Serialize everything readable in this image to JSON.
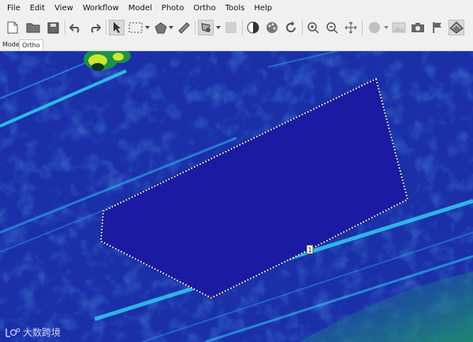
{
  "menu": [
    "File",
    "Edit",
    "View",
    "Workflow",
    "Model",
    "Photo",
    "Ortho",
    "Tools",
    "Help"
  ],
  "toolbar": {
    "icons": [
      "new-document-icon",
      "open-folder-icon",
      "save-icon",
      "undo-icon",
      "redo-icon",
      "pointer-icon",
      "rectangle-selection-icon",
      "polygon-selection-icon",
      "ruler-icon",
      "shape-draw-icon",
      "dense-cloud-icon",
      "contrast-icon",
      "palette-icon",
      "refresh-icon",
      "zoom-in-icon",
      "zoom-out-icon",
      "move-icon",
      "terrain-icon",
      "image-icon",
      "camera-icon",
      "flag-icon",
      "orthomosaic-icon"
    ]
  },
  "tabs": [
    "Model",
    "Ortho"
  ],
  "active_tab": "Ortho",
  "shape": {
    "vertex_label": "1"
  },
  "watermark": {
    "text": "大数跨境"
  },
  "colors": {
    "polygon_fill": "#1b1aa3",
    "dem_base": "#1a2fa8",
    "dem_highlight": "#2fd0f0",
    "dem_low": "#1f8f6a"
  }
}
